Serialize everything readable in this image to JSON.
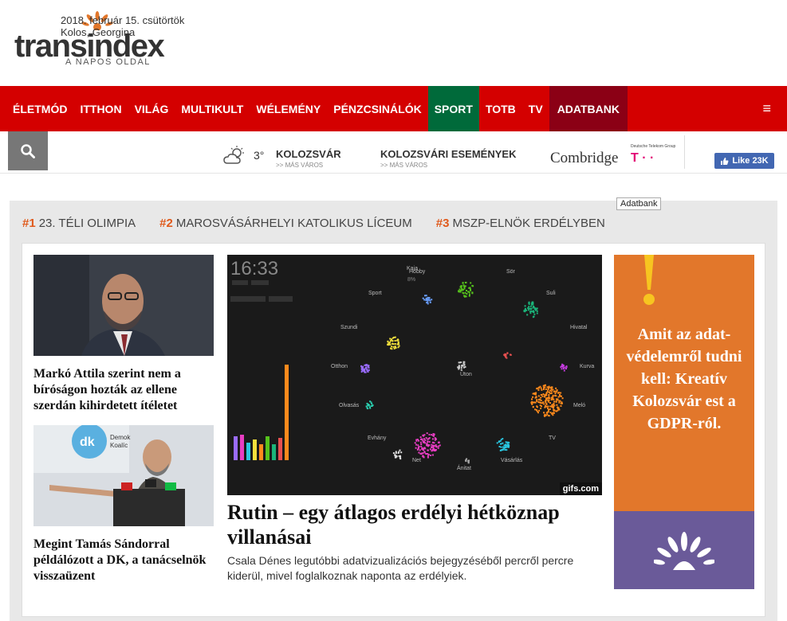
{
  "logo": {
    "name": "transindex",
    "tagline": "A NAPOS OLDAL"
  },
  "nav": {
    "items": [
      "ÉLETMÓD",
      "ITTHON",
      "VILÁG",
      "MULTIKULT",
      "WÉLEMÉNY",
      "PÉNZCSINÁLÓK",
      "SPORT",
      "TOTB",
      "TV",
      "ADATBANK"
    ],
    "menu_glyph": "≡"
  },
  "infobar": {
    "date": "2018. február 15. csütörtök",
    "names": "Kolos, Georgina",
    "temperature": "3°",
    "city": "KOLOZSVÁR",
    "city_sub": ">> MÁS VÁROS",
    "events": "KOLOZSVÁRI ESEMÉNYEK",
    "events_sub": ">> MÁS VÁROS",
    "sponsor": "Combridge",
    "telekom_group": "Deutsche Telekom Group",
    "telekom": "T · ·",
    "fb_like": "Like 23K"
  },
  "tooltip": "Adatbank",
  "topics": [
    {
      "num": "#1",
      "label": "23. TÉLI OLIMPIA"
    },
    {
      "num": "#2",
      "label": "MAROSVÁSÁRHELYI KATOLIKUS LÍCEUM"
    },
    {
      "num": "#3",
      "label": "MSZP-ELNÖK ERDÉLYBEN"
    }
  ],
  "stories": {
    "left1": "Markó Attila szerint nem a bíróságon hozták az ellene szerdán kihirdetett ítéletet",
    "left2": "Megint Tamás Sándorral példálózott a DK, a tanácselnök visszaüzent",
    "main_title": "Rutin – egy átlagos erdélyi hétköznap villanásai",
    "main_lead": "Csala Dénes legutóbbi adatvizualizációs bejegyzéséből percről percre kiderül, mivel foglalkoznak naponta az erdélyiek."
  },
  "gif": {
    "time": "16:33",
    "labels": {
      "kaja": "Kaja",
      "hobby": "Hobby",
      "sor": "Sör",
      "sport": "Sport",
      "suli": "Suli",
      "szundi": "Szundi",
      "hivatal": "Hivatal",
      "otthon": "Otthon",
      "uton": "Úton",
      "kurva": "Kurva",
      "olvasas": "Olvasás",
      "melo": "Meló",
      "tv": "TV",
      "evhany": "Evhány",
      "net": "Net",
      "anitat": "Ánitat",
      "vasarlas": "Vásárlás"
    },
    "watermark": "gifs.com"
  },
  "ad": {
    "text": "Amit az adat-védelemről tudni kell: Kreatív Kolozsvár est a GDPR-ról."
  },
  "colors": {
    "nav": "#d40000",
    "sport": "#006a3a",
    "adatbank": "#8b0015",
    "accent": "#e05a1c",
    "ad": "#e2772b",
    "ad_bottom": "#6a5a99"
  }
}
